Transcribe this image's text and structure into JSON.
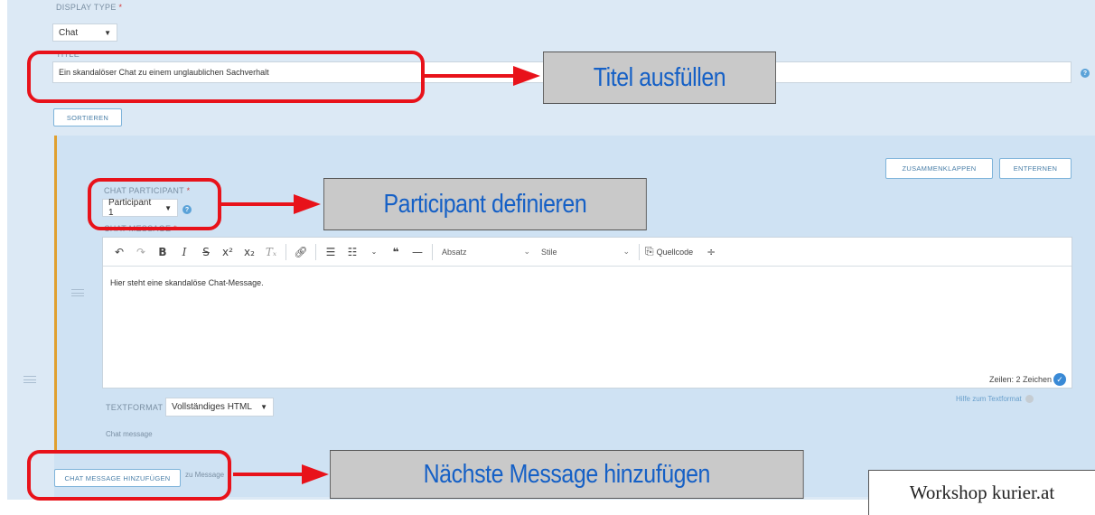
{
  "display_type": {
    "label": "DISPLAY TYPE",
    "required_marker": "*",
    "value": "Chat"
  },
  "title_field": {
    "label": "TITLE",
    "value": "Ein skandalöser Chat zu einem unglaublichen Sachverhalt"
  },
  "buttons": {
    "sort": "SORTIEREN",
    "collapse": "ZUSAMMENKLAPPEN",
    "remove": "ENTFERNEN",
    "add_message": "CHAT MESSAGE HINZUFÜGEN"
  },
  "participant": {
    "label": "CHAT PARTICIPANT",
    "required_marker": "*",
    "value": "Participant 1"
  },
  "message_field": {
    "label": "CHAT MESSAGE",
    "required_marker": "*"
  },
  "editor": {
    "toolbar": {
      "paragraph_dropdown": "Absatz",
      "style_dropdown": "Stile",
      "source_label": "Quellcode"
    },
    "content": "Hier steht eine skandalöse Chat-Message.",
    "stats": "Zeilen: 2 Zeichen"
  },
  "text_format": {
    "label": "TEXTFORMAT",
    "value": "Vollständiges HTML",
    "help_link": "Hilfe zum Textformat"
  },
  "chat_message_hint": "Chat message",
  "add_message_suffix": "zu Message",
  "callouts": {
    "title": "Titel ausfüllen",
    "participant": "Participant definieren",
    "next_message": "Nächste Message hinzufügen"
  },
  "watermark": "Workshop kurier.at",
  "colors": {
    "annotation_red": "#e8121a",
    "callout_text_blue": "#1560c6",
    "callout_bg": "#c9c9c9",
    "panel_bg": "#dce9f5",
    "accent_blue": "#3a8ad6",
    "orange_border": "#e0a030"
  }
}
